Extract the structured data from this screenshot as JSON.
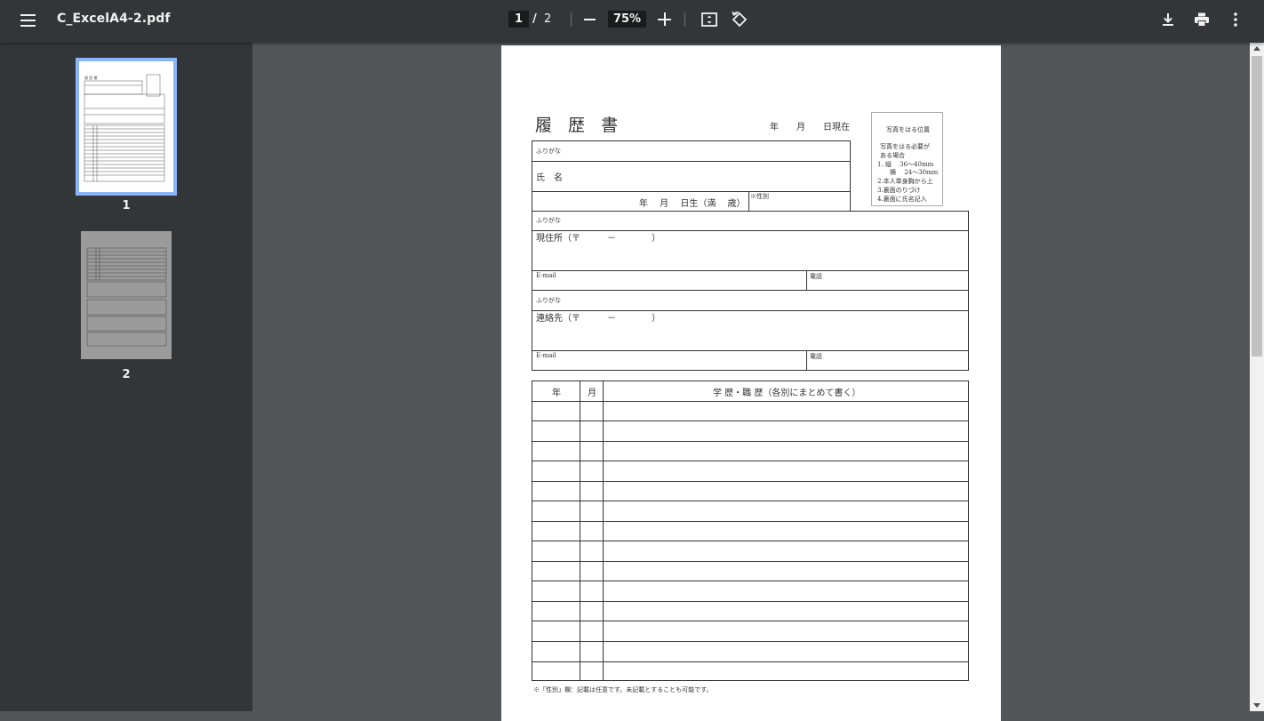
{
  "toolbar": {
    "doc_title": "C_ExcelA4-2.pdf",
    "current_page": "1",
    "page_separator": "/",
    "total_pages": "2",
    "zoom": "75%"
  },
  "thumbnails": [
    {
      "label": "1",
      "selected": true
    },
    {
      "label": "2",
      "selected": false
    }
  ],
  "form": {
    "title": "履 歴 書",
    "date_current": "年　　月　　日現在",
    "photo": {
      "title": "写真をはる位置",
      "line1": "写真をはる必要が",
      "line2": "ある場合",
      "line3": "1. 縦　 36～40mm",
      "line4": "　　横　 24～30mm",
      "line5": "2.本人単身胸から上",
      "line6": "3.裏面のりづけ",
      "line7": "4.裏面に氏名記入"
    },
    "furigana_1": "ふりがな",
    "name_label": "氏　名",
    "birth_label": "年　 月　 日生（満　 歳）",
    "gender_label": "※性別",
    "furigana_2": "ふりがな",
    "address_label": "現住所（〒　　　－　　　　）",
    "email_1": "E-mail",
    "phone_1": "電話",
    "furigana_3": "ふりがな",
    "contact_label": "連絡先（〒　　　－　　　　）",
    "email_2": "E-mail",
    "phone_2": "電話",
    "history_year": "年",
    "history_month": "月",
    "history_title": "学 歴・職 歴（各別にまとめて書く）",
    "footnote": "※「性別」欄：記載は任意です。未記載とすることも可能です。"
  }
}
